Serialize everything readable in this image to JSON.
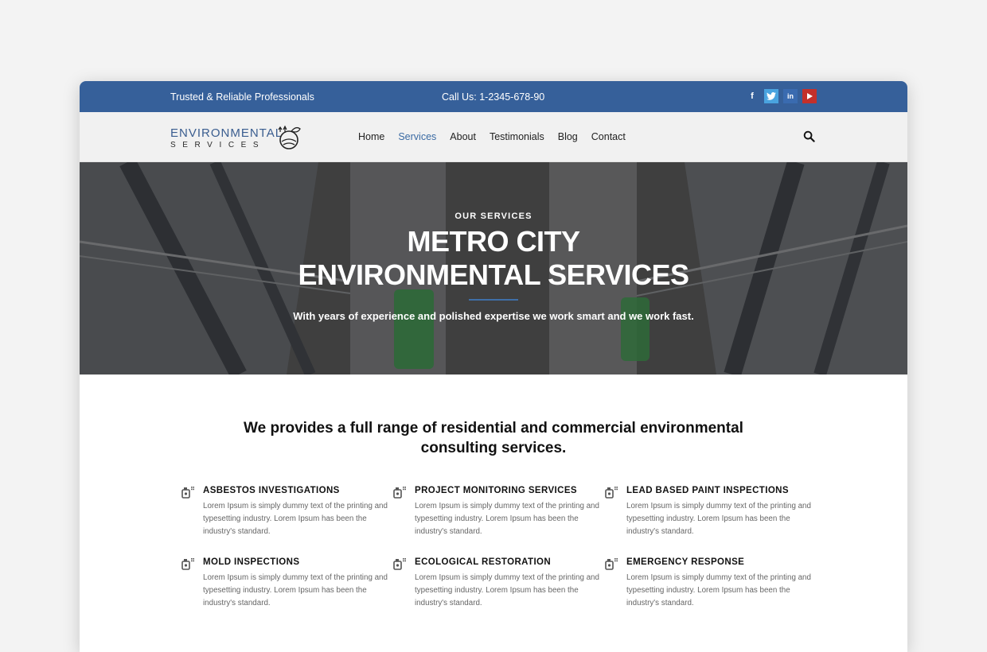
{
  "topbar": {
    "tagline": "Trusted & Reliable Professionals",
    "phone": "Call Us: 1-2345-678-90",
    "social": [
      {
        "name": "facebook-icon",
        "glyph": "f"
      },
      {
        "name": "twitter-icon",
        "glyph": "t"
      },
      {
        "name": "linkedin-icon",
        "glyph": "in"
      },
      {
        "name": "youtube-icon",
        "glyph": "▶"
      }
    ]
  },
  "logo": {
    "line1": "ENVIRONMENTAL",
    "line2": "SERVICES"
  },
  "nav": {
    "items": [
      "Home",
      "Services",
      "About",
      "Testimonials",
      "Blog",
      "Contact"
    ],
    "active": "Services",
    "search_icon": "search-icon"
  },
  "hero": {
    "eyebrow": "OUR SERVICES",
    "title_line1": "METRO CITY",
    "title_line2": "ENVIRONMENTAL SERVICES",
    "subtitle": "With years of experience and polished expertise we work smart and we work fast."
  },
  "intro": {
    "line1": "We provides a full range of residential and commercial environmental",
    "line2": "consulting services."
  },
  "services": [
    {
      "title": "ASBESTOS INVESTIGATIONS",
      "text": "Lorem Ipsum is simply dummy text of the printing and typesetting industry. Lorem Ipsum has been the industry's standard."
    },
    {
      "title": "PROJECT MONITORING SERVICES",
      "text": "Lorem Ipsum is simply dummy text of the printing and typesetting industry. Lorem Ipsum has been the industry's standard."
    },
    {
      "title": "LEAD BASED PAINT INSPECTIONS",
      "text": "Lorem Ipsum is simply dummy text of the printing and typesetting industry. Lorem Ipsum has been the industry's standard."
    },
    {
      "title": "MOLD INSPECTIONS",
      "text": "Lorem Ipsum is simply dummy text of the printing and typesetting industry. Lorem Ipsum has been the industry's standard."
    },
    {
      "title": "ECOLOGICAL RESTORATION",
      "text": "Lorem Ipsum is simply dummy text of the printing and typesetting industry. Lorem Ipsum has been the industry's standard."
    },
    {
      "title": "EMERGENCY RESPONSE",
      "text": "Lorem Ipsum is simply dummy text of the printing and typesetting industry. Lorem Ipsum has been the industry's standard."
    }
  ],
  "colors": {
    "brand_blue": "#36609a",
    "accent_blue": "#3a6aa3"
  }
}
